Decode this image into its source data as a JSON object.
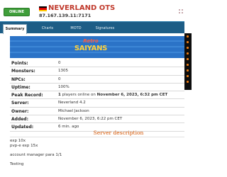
{
  "header": {
    "status": "ONLINE",
    "server_name": "NEVERLAND OTS",
    "server_ip": "87.167.139.11:7171",
    "flag_icon": "germany-flag-icon",
    "menu_icon": "grid-menu-icon"
  },
  "tabs": [
    {
      "label": "Summary",
      "active": true
    },
    {
      "label": "Charts",
      "active": false
    },
    {
      "label": "MOTD",
      "active": false
    },
    {
      "label": "Signatures",
      "active": false
    }
  ],
  "banner": {
    "logo_top": "Retro",
    "logo_bottom": "SAIYANS"
  },
  "info": [
    {
      "label": "Points:",
      "value": "0"
    },
    {
      "label": "Monsters:",
      "value": "1305"
    },
    {
      "label": "NPCs:",
      "value": "0"
    },
    {
      "label": "Uptime:",
      "value": "100%"
    },
    {
      "label": "Peak Record:",
      "value_bold": "1",
      "value": " players online on ",
      "value_bold2": "November 6, 2023, 6:32 pm CET"
    },
    {
      "label": "Server:",
      "value": "Neverland 4.2"
    },
    {
      "label": "Owner:",
      "value": "Michael Jackson"
    },
    {
      "label": "Added:",
      "value": "November 6, 2023, 6:22 pm CET"
    },
    {
      "label": "Updated:",
      "value": "6 min. ago"
    }
  ],
  "description": {
    "title": "Server description",
    "lines": [
      "exp 10x",
      "pvp-e exp 15x",
      "",
      "account manager para 1/1",
      "",
      "Testing"
    ]
  },
  "colors": {
    "online": "#3f9e3a",
    "title_red": "#c0392b",
    "tabbar": "#1d5d86",
    "desc_title": "#d35400"
  }
}
